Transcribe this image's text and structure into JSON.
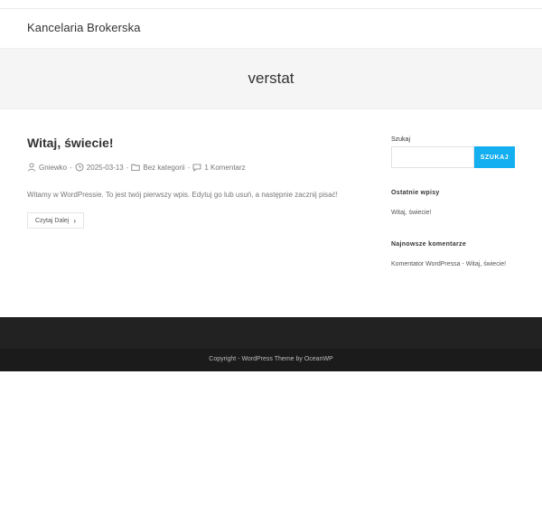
{
  "site": {
    "title": "Kancelaria Brokerska"
  },
  "page_header": {
    "title": "verstat"
  },
  "post": {
    "title": "Witaj, świecie!",
    "author": "Gniewko",
    "date": "2025-03-13",
    "category": "Bez kategorii",
    "comments": "1 Komentarz",
    "separator": "-",
    "excerpt": "Witamy w WordPressie. To jest twój pierwszy wpis. Edytuj go lub usuń, a następnie zacznij pisać!",
    "read_more": "Czytaj Dalej"
  },
  "sidebar": {
    "search_label": "Szukaj",
    "search_value": "",
    "search_button": "SZUKAJ",
    "recent_posts_title": "Ostatnie wpisy",
    "recent_posts": [
      "Witaj, świecie!"
    ],
    "recent_comments_title": "Najnowsze komentarze",
    "recent_comment": {
      "author": "Komentator WordPressa",
      "separator": " - ",
      "post": "Witaj, świecie!"
    }
  },
  "footer": {
    "copyright": "Copyright - WordPress Theme by OceanWP"
  },
  "colors": {
    "accent": "#13aff0",
    "footer": "#222222",
    "footer_bottom": "#1b1b1b"
  },
  "icons": {
    "author": "user-icon",
    "date": "clock-icon",
    "category": "folder-icon",
    "comments": "comment-icon",
    "read_more": "chevron-right-icon"
  }
}
